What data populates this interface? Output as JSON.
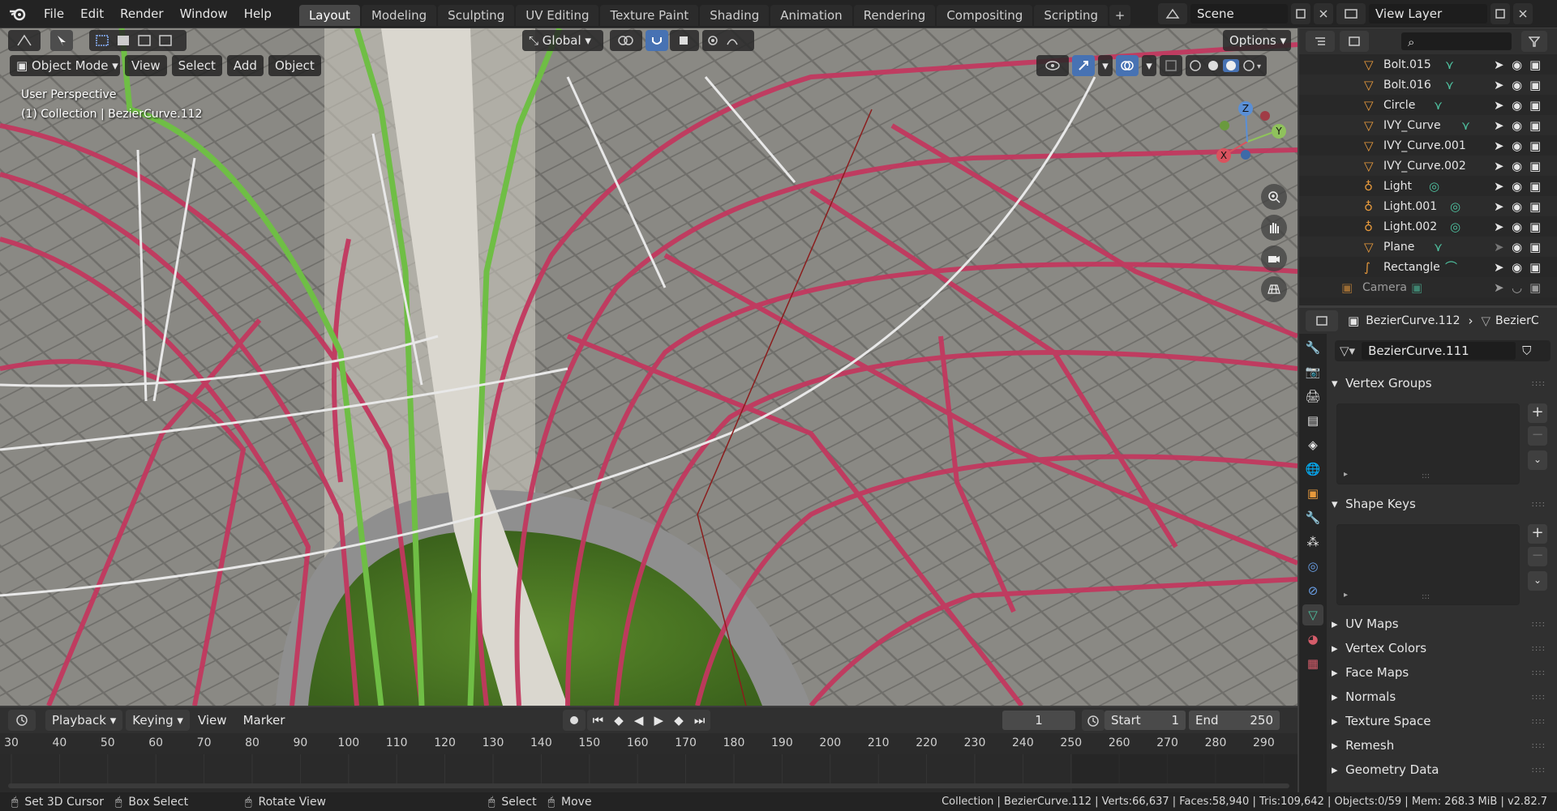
{
  "menu": {
    "file": "File",
    "edit": "Edit",
    "render": "Render",
    "window": "Window",
    "help": "Help"
  },
  "workspaces": [
    "Layout",
    "Modeling",
    "Sculpting",
    "UV Editing",
    "Texture Paint",
    "Shading",
    "Animation",
    "Rendering",
    "Compositing",
    "Scripting"
  ],
  "active_workspace": "Layout",
  "scene": "Scene",
  "view_layer": "View Layer",
  "viewport": {
    "mode": "Object Mode",
    "menus": [
      "View",
      "Select",
      "Add",
      "Object"
    ],
    "transform_orientation": "Global",
    "options": "Options",
    "perspective": "User Perspective",
    "collection_info": "(1) Collection | BezierCurve.112",
    "gizmo": {
      "x": "X",
      "y": "Y",
      "z": "Z"
    }
  },
  "outliner": {
    "search_placeholder": "",
    "items": [
      {
        "name": "Bolt.015"
      },
      {
        "name": "Bolt.016"
      },
      {
        "name": "Circle"
      },
      {
        "name": "IVY_Curve"
      },
      {
        "name": "IVY_Curve.001"
      },
      {
        "name": "IVY_Curve.002"
      },
      {
        "name": "Light"
      },
      {
        "name": "Light.001"
      },
      {
        "name": "Light.002"
      },
      {
        "name": "Plane"
      },
      {
        "name": "Rectangle"
      },
      {
        "name": "Camera"
      }
    ]
  },
  "properties": {
    "breadcrumb_object": "BezierCurve.112",
    "breadcrumb_data": "BezierC",
    "datablock": "BezierCurve.111",
    "panels": {
      "vertex_groups": "Vertex Groups",
      "shape_keys": "Shape Keys",
      "uv_maps": "UV Maps",
      "vertex_colors": "Vertex Colors",
      "face_maps": "Face Maps",
      "normals": "Normals",
      "texture_space": "Texture Space",
      "remesh": "Remesh",
      "geometry_data": "Geometry Data"
    }
  },
  "timeline": {
    "playback": "Playback",
    "keying": "Keying",
    "view": "View",
    "marker": "Marker",
    "current_frame": "1",
    "start_label": "Start",
    "start": "1",
    "end_label": "End",
    "end": "250",
    "ticks": [
      "30",
      "40",
      "50",
      "60",
      "70",
      "80",
      "90",
      "100",
      "110",
      "120",
      "130",
      "140",
      "150",
      "160",
      "170",
      "180",
      "190",
      "200",
      "210",
      "220",
      "230",
      "240",
      "250",
      "260",
      "270",
      "280",
      "290"
    ]
  },
  "status": {
    "set_cursor": "Set 3D Cursor",
    "box_select": "Box Select",
    "rotate_view": "Rotate View",
    "select": "Select",
    "move": "Move",
    "stats": "Collection | BezierCurve.112 | Verts:66,637 | Faces:58,940 | Tris:109,642 | Objects:0/59 | Mem: 268.3 MiB | v2.82.7"
  },
  "colors": {
    "accent": "#4772b3",
    "curve": "#c2385f",
    "ivy": "#6fbe45",
    "grid": "#6a6a66"
  }
}
